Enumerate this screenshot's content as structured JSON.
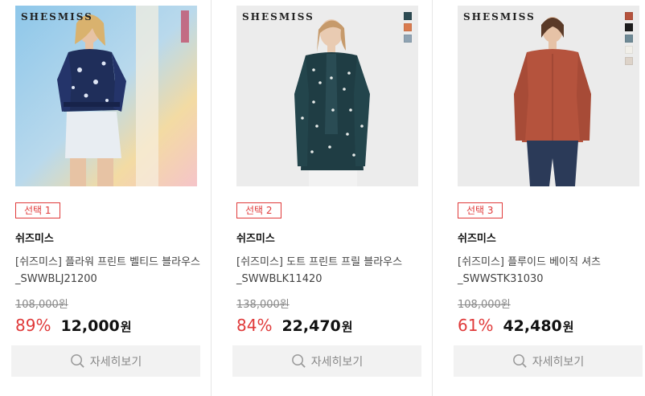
{
  "products": [
    {
      "brand_logo": "SHESMISS",
      "select_label": "선택 1",
      "brand": "쉬즈미스",
      "name": "[쉬즈미스] 플라워 프린트 벨티드 블라우스_SWWBLJ21200",
      "original_price": "108,000원",
      "discount": "89%",
      "price": "12,000",
      "currency": "원",
      "detail_label": "자세히보기",
      "swatches": []
    },
    {
      "brand_logo": "SHESMISS",
      "select_label": "선택 2",
      "brand": "쉬즈미스",
      "name": "[쉬즈미스] 도트 프린트 프릴 블라우스_SWWBLK11420",
      "original_price": "138,000원",
      "discount": "84%",
      "price": "22,470",
      "currency": "원",
      "detail_label": "자세히보기",
      "swatches": [
        "#2c4a52",
        "#d97b4f",
        "#8fa3b3"
      ]
    },
    {
      "brand_logo": "SHESMISS",
      "select_label": "선택 3",
      "brand": "쉬즈미스",
      "name": "[쉬즈미스] 플루이드 베이직 셔츠_SWWSTK31030",
      "original_price": "108,000원",
      "discount": "61%",
      "price": "42,480",
      "currency": "원",
      "detail_label": "자세히보기",
      "swatches": [
        "#b5533d",
        "#1c1c1c",
        "#6f8a96",
        "#f1efe9",
        "#ddd3c9"
      ]
    }
  ]
}
